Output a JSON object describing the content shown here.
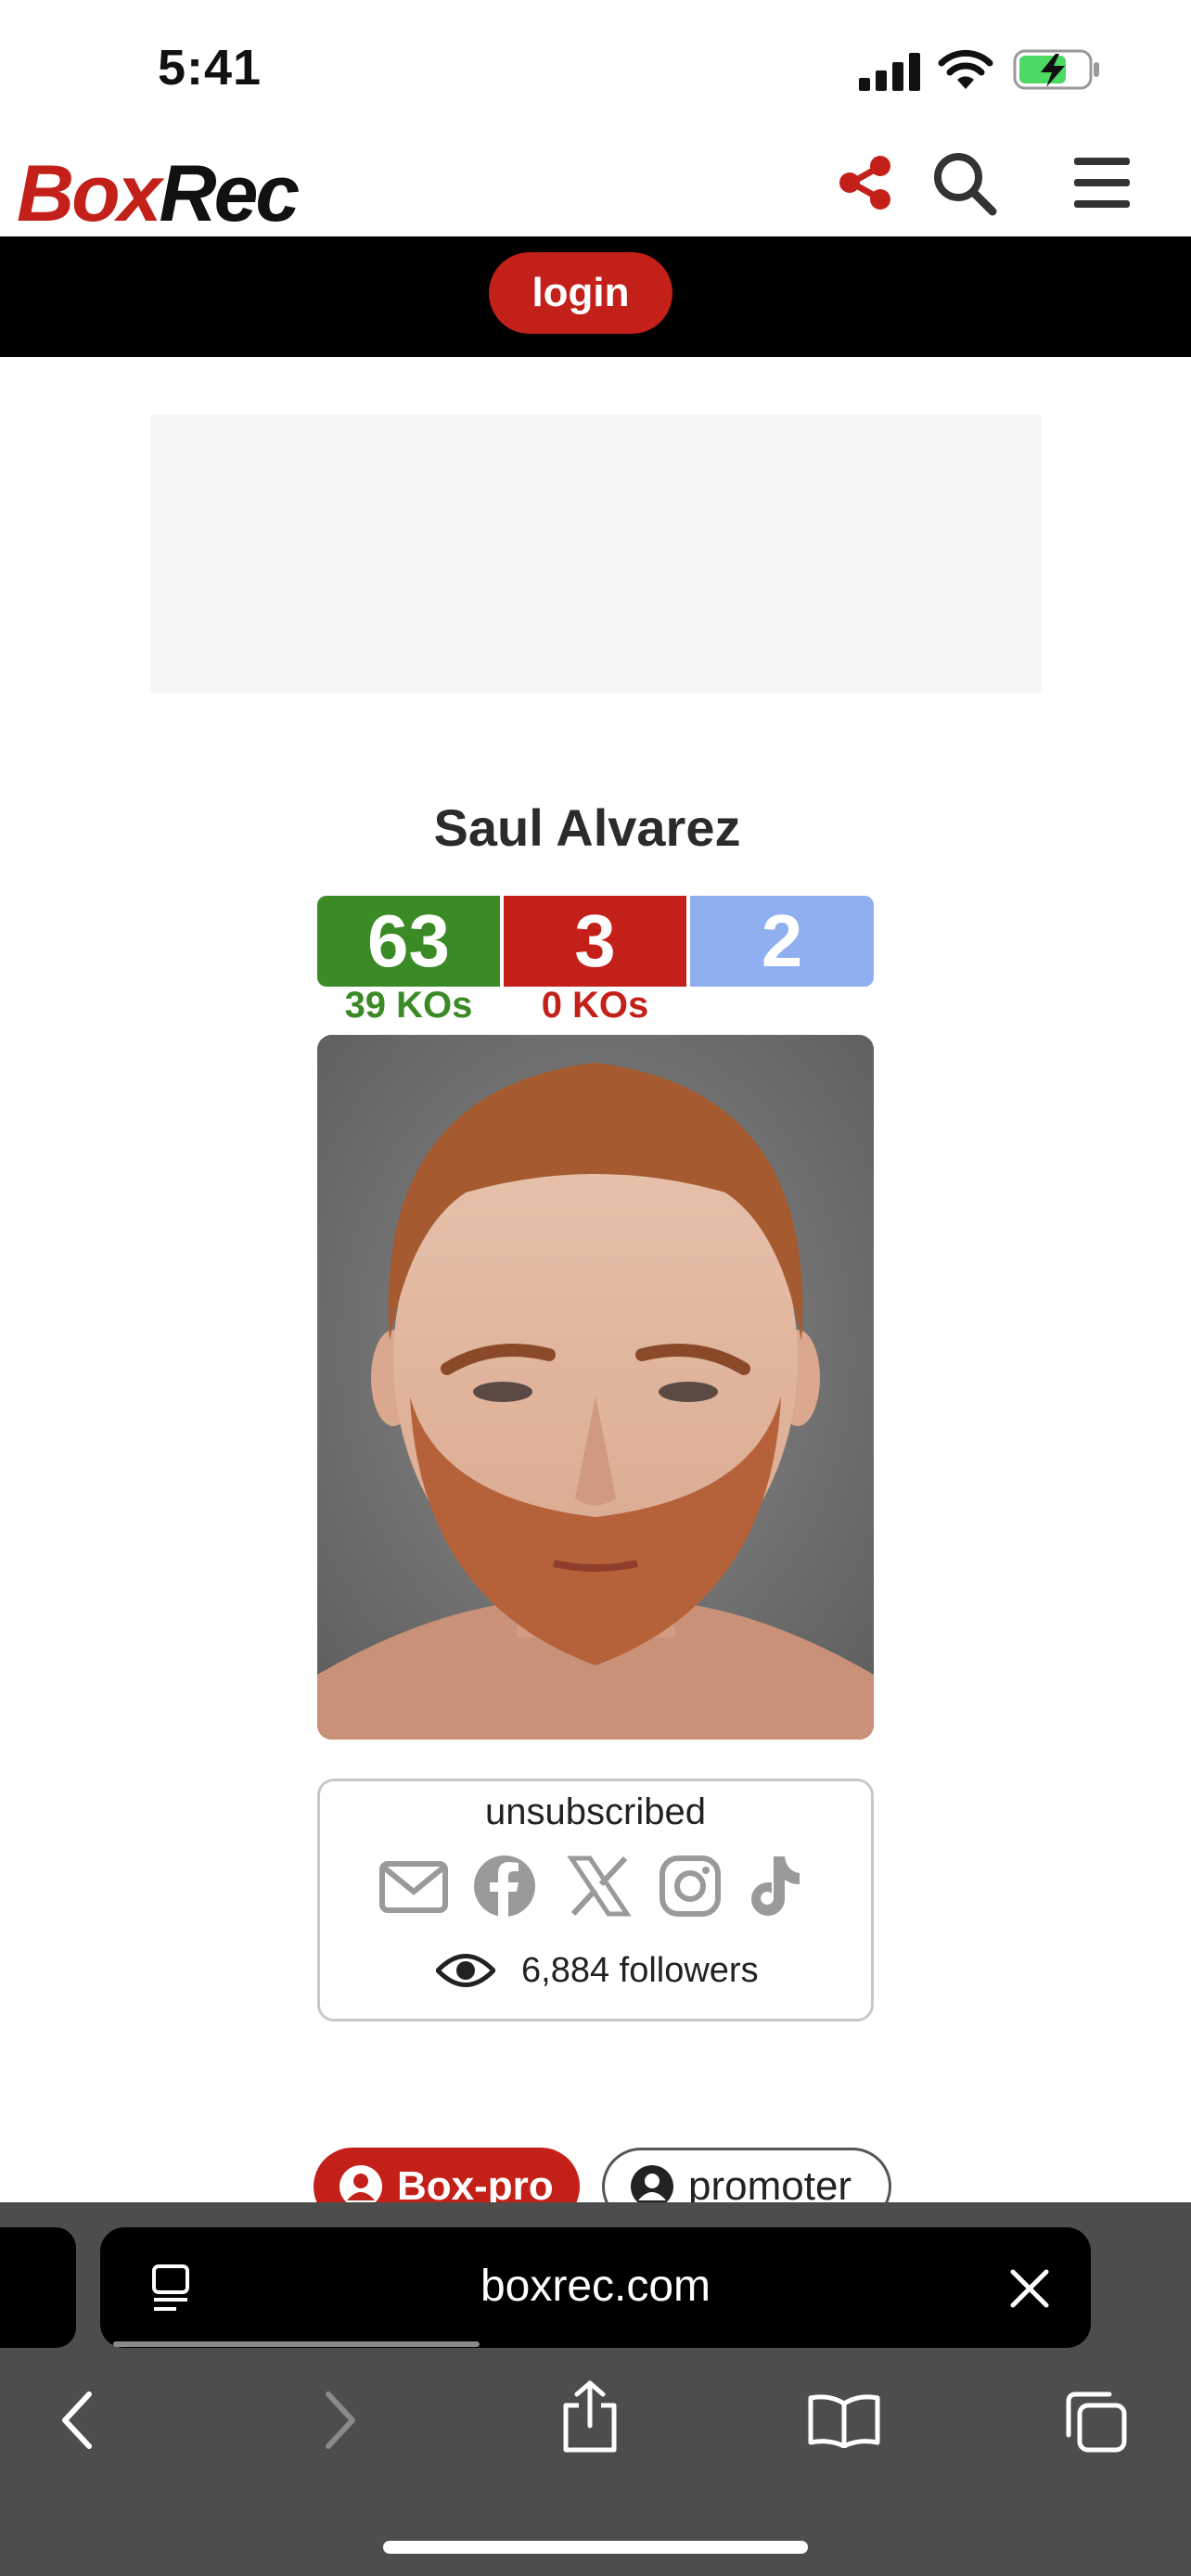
{
  "status_bar": {
    "time": "5:41",
    "battery_color": "#4cd964"
  },
  "header": {
    "logo_part1": "Box",
    "logo_part2": "Rec",
    "brand_color": "#c4201a",
    "share_icon": "share-icon",
    "search_icon": "search-icon",
    "menu_icon": "hamburger-menu-icon"
  },
  "login": {
    "label": "login"
  },
  "boxer": {
    "name": "Saul Alvarez",
    "record": {
      "wins": "63",
      "losses": "3",
      "draws": "2",
      "wins_ko": "39 KOs",
      "losses_ko": "0 KOs",
      "wins_color": "#3a8a25",
      "losses_color": "#c4201a",
      "draws_color": "#8faff0"
    }
  },
  "subscription": {
    "status": "unsubscribed",
    "social_icons": [
      "email-icon",
      "facebook-icon",
      "x-icon",
      "instagram-icon",
      "tiktok-icon"
    ],
    "followers": "6,884 followers"
  },
  "role_tabs": [
    {
      "label": "Box-pro",
      "active": true
    },
    {
      "label": "promoter",
      "active": false
    }
  ],
  "browser": {
    "url": "boxrec.com",
    "load_progress": 0.38
  }
}
